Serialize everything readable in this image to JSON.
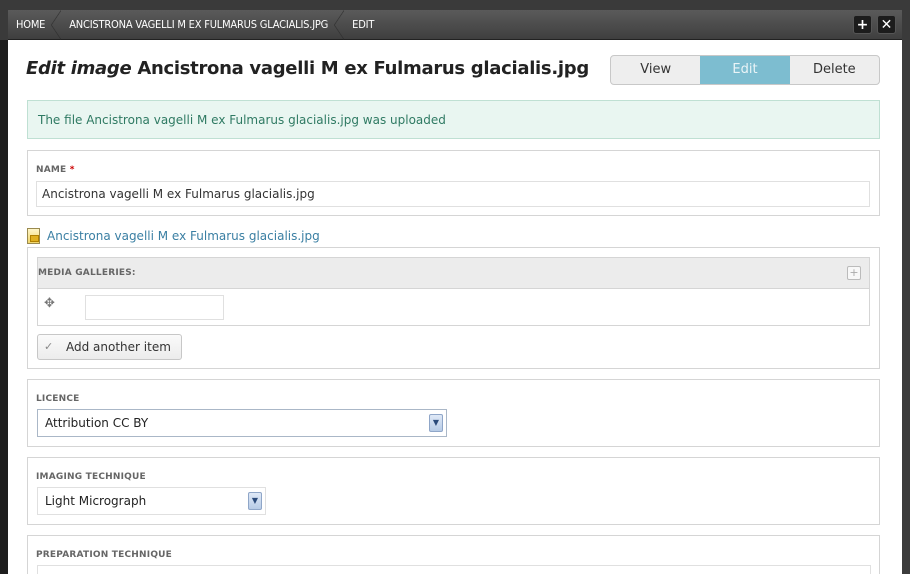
{
  "breadcrumb": {
    "items": [
      "Home",
      "Ancistrona vagelli M ex Fulmarus glacialis.jpg",
      "Edit"
    ]
  },
  "toolbar": {
    "add_symbol": "+",
    "close_symbol": "✕"
  },
  "backdrop_link": "c",
  "page": {
    "title_prefix": "Edit image",
    "title_name": "Ancistrona vagelli M ex Fulmarus glacialis.jpg"
  },
  "tabs": [
    {
      "label": "View",
      "active": false
    },
    {
      "label": "Edit",
      "active": true
    },
    {
      "label": "Delete",
      "active": false
    }
  ],
  "status_message": "The file Ancistrona vagelli M ex Fulmarus glacialis.jpg was uploaded",
  "fields": {
    "name": {
      "label": "Name",
      "required_mark": "*",
      "value": "Ancistrona vagelli M ex Fulmarus glacialis.jpg"
    },
    "file_link": "Ancistrona vagelli M ex Fulmarus glacialis.jpg",
    "media_galleries": {
      "label": "Media galleries:",
      "value": "",
      "add_label": "Add another item"
    },
    "licence": {
      "label": "Licence",
      "selected": "Attribution CC BY"
    },
    "imaging_technique": {
      "label": "Imaging technique",
      "selected": "Light Micrograph"
    },
    "preparation_technique": {
      "label": "Preparation technique",
      "value": ""
    }
  },
  "icons": {
    "expand": "expand-icon",
    "drag": "drag-handle-icon",
    "check": "check-icon",
    "file": "file-image-icon",
    "select_arrow": "chevron-down-icon"
  },
  "colors": {
    "active_tab": "#7dbdd0",
    "status_bg": "#e9f6f1",
    "status_text": "#2f7a63",
    "link": "#3a7fa3"
  }
}
